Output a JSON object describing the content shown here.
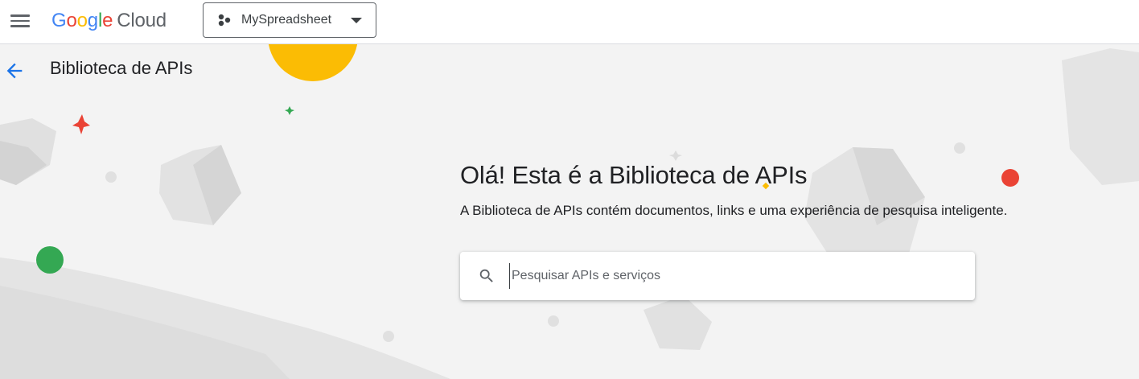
{
  "topbar": {
    "logo": {
      "letters": [
        "G",
        "o",
        "o",
        "g",
        "l",
        "e"
      ],
      "cloud": "Cloud"
    },
    "project": {
      "name": "MySpreadsheet"
    }
  },
  "header": {
    "title": "Biblioteca de APIs"
  },
  "hero": {
    "title": "Olá! Esta é a Biblioteca de APIs",
    "subtitle": "A Biblioteca de APIs contém documentos, links e uma experiência de pesquisa inteligente."
  },
  "search": {
    "placeholder": "Pesquisar APIs e serviços",
    "value": ""
  },
  "colors": {
    "google_blue": "#4285f4",
    "google_red": "#ea4335",
    "google_yellow": "#fbbc04",
    "google_green": "#34a853",
    "grey_text": "#5f6368",
    "back_arrow": "#1a73e8"
  },
  "icons": [
    "menu-icon",
    "project-icon",
    "caret-down-icon",
    "back-arrow-icon",
    "search-icon"
  ]
}
